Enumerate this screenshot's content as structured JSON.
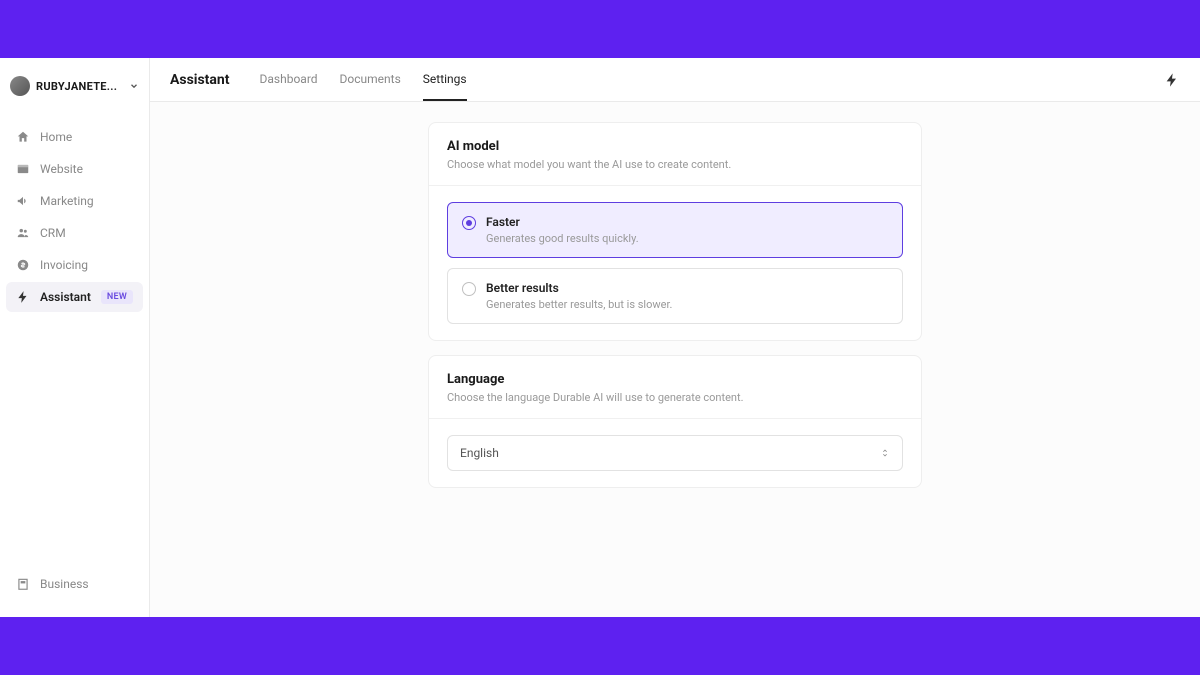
{
  "banner": {
    "color": "#5e21f0"
  },
  "user": {
    "name": "RUBYJANETE..."
  },
  "sidebar": {
    "items": [
      {
        "label": "Home",
        "icon": "home-icon"
      },
      {
        "label": "Website",
        "icon": "website-icon"
      },
      {
        "label": "Marketing",
        "icon": "marketing-icon"
      },
      {
        "label": "CRM",
        "icon": "crm-icon"
      },
      {
        "label": "Invoicing",
        "icon": "invoicing-icon"
      },
      {
        "label": "Assistant",
        "icon": "assistant-icon",
        "badge": "NEW",
        "active": true
      }
    ],
    "footer": {
      "label": "Business",
      "icon": "business-icon"
    }
  },
  "page": {
    "title": "Assistant"
  },
  "tabs": [
    {
      "label": "Dashboard"
    },
    {
      "label": "Documents"
    },
    {
      "label": "Settings",
      "active": true
    }
  ],
  "ai_model": {
    "title": "AI model",
    "description": "Choose what model you want the AI use to create content.",
    "options": [
      {
        "title": "Faster",
        "desc": "Generates good results quickly.",
        "selected": true
      },
      {
        "title": "Better results",
        "desc": "Generates better results, but is slower.",
        "selected": false
      }
    ]
  },
  "language": {
    "title": "Language",
    "description": "Choose the language Durable AI will use to generate content.",
    "value": "English"
  }
}
